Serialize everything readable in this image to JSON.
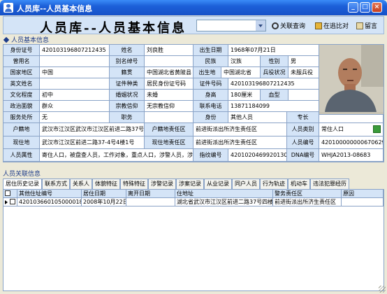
{
  "window": {
    "title": "人员库--人员基本信息"
  },
  "header": {
    "title": "人员库--人员基本信息",
    "query_label": "关联查询",
    "compare_label": "在逃比对",
    "message_label": "留言",
    "combo_value": ""
  },
  "sections": {
    "basic": "人员基本信息",
    "related": "人员关联信息"
  },
  "info": {
    "id_label": "身份证号",
    "id_value": "420103196807212435",
    "name_label": "姓名",
    "name_value": "刘良胜",
    "birth_label": "出生日期",
    "birth_value": "1968年07月21日",
    "used_name_label": "曾用名",
    "used_name_value": "",
    "alias_label": "别名绰号",
    "alias_value": "",
    "ethnicity_label": "民族",
    "ethnicity_value": "汉族",
    "gender_label": "性别",
    "gender_value": "男",
    "country_label": "国家地区",
    "country_value": "中国",
    "native_label": "籍贯",
    "native_value": "中国湖北省黄陂县",
    "birthplace_label": "出生地",
    "birthplace_value": "中国湖北省",
    "military_label": "兵役状况",
    "military_value": "未服兵役",
    "en_name_label": "英文姓名",
    "en_name_value": "",
    "cert_type_label": "证件种类",
    "cert_type_value": "居民身份证号码",
    "cert_no_label": "证件号码",
    "cert_no_value": "420103196807212435",
    "edu_label": "文化程度",
    "edu_value": "初中",
    "marital_label": "婚姻状况",
    "marital_value": "未婚",
    "height_label": "身高",
    "height_value": "180厘米",
    "blood_label": "血型",
    "blood_value": "",
    "political_label": "政治面貌",
    "political_value": "群众",
    "religion_label": "宗教信仰",
    "religion_value": "无宗教信仰",
    "phone_label": "联系电话",
    "phone_value": "13871184099",
    "service_label": "服务处所",
    "service_value": "无",
    "duty_label": "职务",
    "duty_value": "",
    "identity_label": "身份",
    "identity_value": "其他人员",
    "skill_label": "专长",
    "skill_value": "",
    "household_label": "户籍地",
    "household_value": "武汉市江汉区武汉市江汉区前进二路37号",
    "household_office_label": "户籍地责任区",
    "household_office_value": "前进街派出所济生责任区",
    "category_label": "人员类别",
    "category_value": "常住人口",
    "address_label": "现住地",
    "address_value": "武汉市江汉区前进二路37-4号4楼1号",
    "address_office_label": "现住地责任区",
    "address_office_value": "前进街派出所济生责任区",
    "person_no_label": "人员编号",
    "person_no_value": "4201000000006706298",
    "attr_label": "人员属性",
    "attr_value": "寄住人口，被盘查人员，工作对象，重点人口，涉警人员，涉案人员",
    "fingerprint_label": "指纹编号",
    "fingerprint_value": "42010204699201307004",
    "dna_label": "DNA编号",
    "dna_value": "WHJA2013-08683"
  },
  "tabs": [
    "居住历史记录",
    "联系方式",
    "关系人",
    "体貌特征",
    "特殊特征",
    "涉警记录",
    "涉案记录",
    "从业记录",
    "同户人员",
    "行为轨迹",
    "机动车",
    "违法犯罪经历"
  ],
  "table": {
    "headers": [
      "其他住址编号",
      "居住日期",
      "离开日期",
      "住地址",
      "警务责任区",
      "原因"
    ],
    "rows": [
      [
        "420103660105000018741",
        "2008年10月22日",
        "",
        "湖北省武汉市江汉区前进二路37号四楼1号",
        "前进街派出所济生责任区",
        ""
      ]
    ]
  }
}
